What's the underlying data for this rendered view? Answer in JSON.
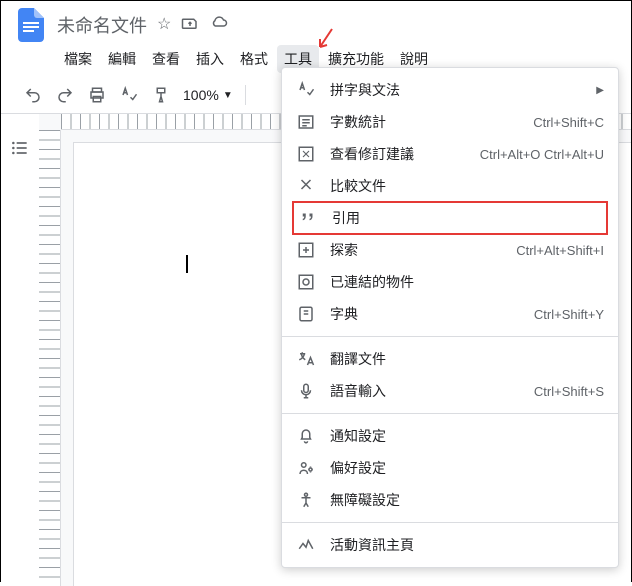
{
  "doc": {
    "title": "未命名文件"
  },
  "menubar": {
    "file": "檔案",
    "edit": "編輯",
    "view": "查看",
    "insert": "插入",
    "format": "格式",
    "tools": "工具",
    "extensions": "擴充功能",
    "help": "說明"
  },
  "toolbar": {
    "zoom": "100%"
  },
  "menu": {
    "spelling": {
      "label": "拼字與文法"
    },
    "wordcount": {
      "label": "字數統計",
      "shortcut": "Ctrl+Shift+C"
    },
    "review": {
      "label": "查看修訂建議",
      "shortcut": "Ctrl+Alt+O Ctrl+Alt+U"
    },
    "compare": {
      "label": "比較文件"
    },
    "citation": {
      "label": "引用"
    },
    "explore": {
      "label": "探索",
      "shortcut": "Ctrl+Alt+Shift+I"
    },
    "linked": {
      "label": "已連結的物件"
    },
    "dictionary": {
      "label": "字典",
      "shortcut": "Ctrl+Shift+Y"
    },
    "translate": {
      "label": "翻譯文件"
    },
    "voice": {
      "label": "語音輸入",
      "shortcut": "Ctrl+Shift+S"
    },
    "notifications": {
      "label": "通知設定"
    },
    "preferences": {
      "label": "偏好設定"
    },
    "accessibility": {
      "label": "無障礙設定"
    },
    "activity": {
      "label": "活動資訊主頁"
    }
  }
}
